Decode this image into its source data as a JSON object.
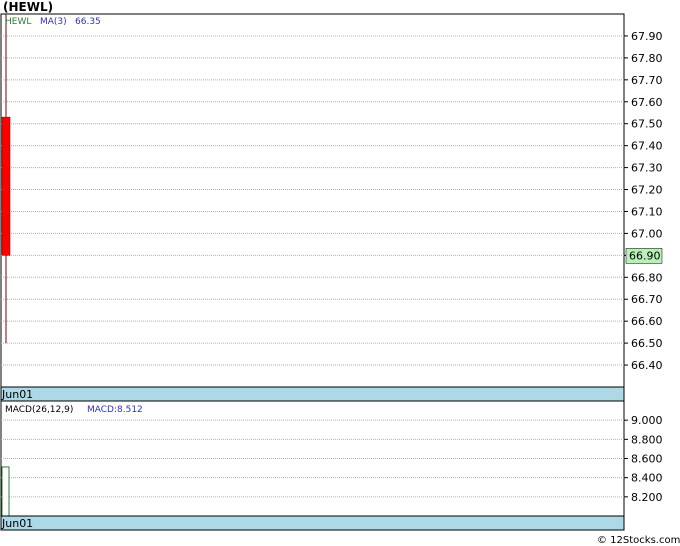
{
  "title": "(HEWL)",
  "copyright": "© 12Stocks.com",
  "chart_data": [
    {
      "type": "candlestick",
      "name": "price",
      "legend": [
        {
          "text": "HEWL",
          "color": "#2e7d32"
        },
        {
          "text": "MA(3)",
          "color": "#3030c0"
        },
        {
          "text": "66.35",
          "color": "#3030c0"
        }
      ],
      "x_categories": [
        "Jun01"
      ],
      "ylim": [
        66.3,
        68.0
      ],
      "y_ticks": [
        "67.90",
        "67.80",
        "67.70",
        "67.60",
        "67.50",
        "67.40",
        "67.30",
        "67.20",
        "67.10",
        "67.00",
        "66.90",
        "66.80",
        "66.70",
        "66.60",
        "66.50",
        "66.40"
      ],
      "candles": [
        {
          "date": "Jun01",
          "open": 67.53,
          "close": 66.9,
          "high": 68.0,
          "low": 66.5,
          "color": "#ff0000"
        }
      ],
      "last_price_label": "66.90",
      "last_price_color": "#b8f0b8",
      "grid": true
    },
    {
      "type": "bar",
      "name": "macd",
      "legend": [
        {
          "text": "MACD(26,12,9)",
          "color": "#000000"
        },
        {
          "text": "MACD:8.512",
          "color": "#3030c0"
        }
      ],
      "x_categories": [
        "Jun01"
      ],
      "ylim": [
        8.0,
        9.2
      ],
      "y_ticks": [
        "9.000",
        "8.800",
        "8.600",
        "8.400",
        "8.200"
      ],
      "values": [
        8.512
      ],
      "bar_color": "#2e7d32",
      "grid": true
    }
  ]
}
